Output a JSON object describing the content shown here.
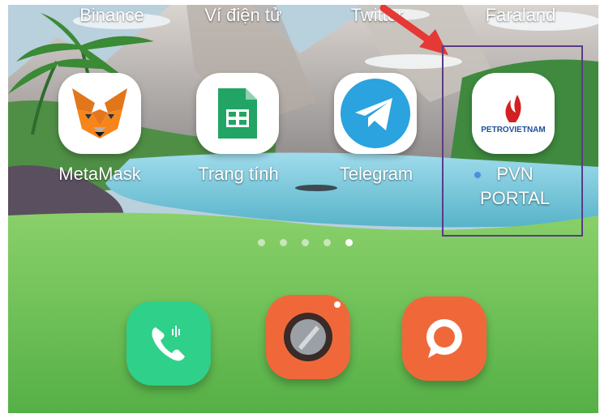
{
  "top_row": [
    "Binance",
    "Ví điện tử",
    "Twitter",
    "Faraland"
  ],
  "apps": [
    {
      "label": "MetaMask",
      "icon": "metamask-fox-icon"
    },
    {
      "label": "Trang tính",
      "icon": "sheets-icon"
    },
    {
      "label": "Telegram",
      "icon": "telegram-icon"
    },
    {
      "label_line1": "PVN",
      "label_line2": "PORTAL",
      "logo_text": "PETROVIETNAM",
      "icon": "petrovietnam-logo-icon"
    }
  ],
  "dock": [
    {
      "name": "phone",
      "icon": "phone-icon",
      "color": "#2fd08a"
    },
    {
      "name": "camera",
      "icon": "camera-icon",
      "color": "#f0683a"
    },
    {
      "name": "messages",
      "icon": "chat-bubble-icon",
      "color": "#f0683a"
    }
  ],
  "page_indicator": {
    "count": 5,
    "active": 5
  },
  "colors": {
    "highlight_border": "#5b3b86",
    "arrow": "#e53935",
    "new_app_dot": "#4a90e2"
  }
}
